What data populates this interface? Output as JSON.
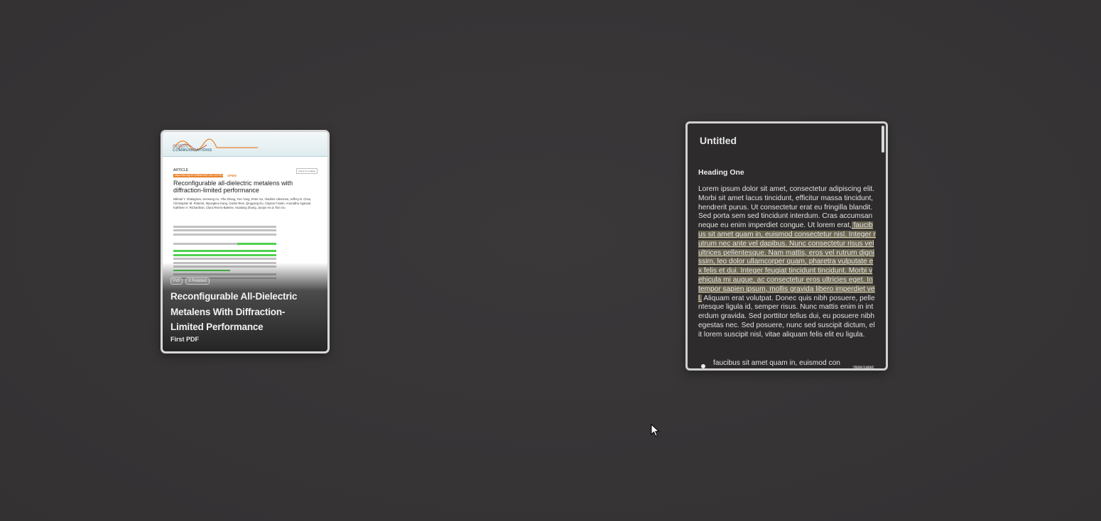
{
  "pdf_card": {
    "journal": {
      "name_line_1": "nature",
      "name_line_2": "COMMUNICATIONS"
    },
    "kicker": "ARTICLE",
    "doi": "https://doi.org/10.1038/s41467-021-22178-3",
    "open_access": "OPEN",
    "check_updates": "Check for updates",
    "paper_title": "Reconfigurable all-dielectric metalens with diffraction-limited performance",
    "authors": "Mikhail Y. Shalaginov, Sensong An, Yifei Zhang, Fan Yang, Peter Su, Vladimir Liberman, Jeffrey B. Chou, Christopher M. Roberts, Myungkoo Kang, Carlos Rios, Qingyang Du, Clayton Fowler, Anuradha Agarwal, Kathleen A. Richardson, Clara Rivero-Baleine, Hualiang Zhang, Juejun Hu & Tian Gu",
    "chips": [
      "Pdf",
      "3 Related"
    ],
    "title": "Reconfigurable All-Dielectric Metalens With Diffraction-Limited Performance",
    "subtitle": "First PDF"
  },
  "note_card": {
    "title": "Untitled",
    "heading": "Heading One",
    "body_before": "Lorem ipsum dolor sit amet, consectetur adipiscing elit. Morbi sit amet lacus tincidunt, efficitur massa tincidunt, hendrerit purus. Ut consectetur erat eu fringilla blandit. Sed porta sem sed tincidunt interdum. Cras accumsan neque eu enim imperdiet congue. Ut lorem erat,",
    "body_highlight": " faucibus sit amet quam in, euismod consectetur nisl. Integer rutrum nec ante vel dapibus. Nunc consectetur risus vel ultrices pellentesque. Nam mattis, eros vel rutrum dignissim, leo dolor ullamcorper quam, pharetra vulputate ex felis et dui. Integer feugiat tincidunt tincidunt. Morbi vehicula mi augue, ac consectetur eros ultricies eget. In tempor sapien ipsum, mollis gravida libero imperdiet vel.",
    "body_after": " Aliquam erat volutpat. Donec quis nibh posuere, pellentesque ligula id, semper risus. Nunc mattis enim in interdum gravida. Sed porttitor tellus dui, eu posuere nibh egestas nec. Sed posuere, nunc sed suscipit dictum, elit lorem suscipit nisl, vitae aliquam felis elit eu ligula.",
    "label_text": "faucibus sit amet quam in, euismod con",
    "label_tag": "Note Label"
  },
  "colors": {
    "background": "#373536",
    "highlight_note": "#6b6551",
    "highlight_pdf": "#4fd24f",
    "accent_orange": "#e8842f"
  }
}
